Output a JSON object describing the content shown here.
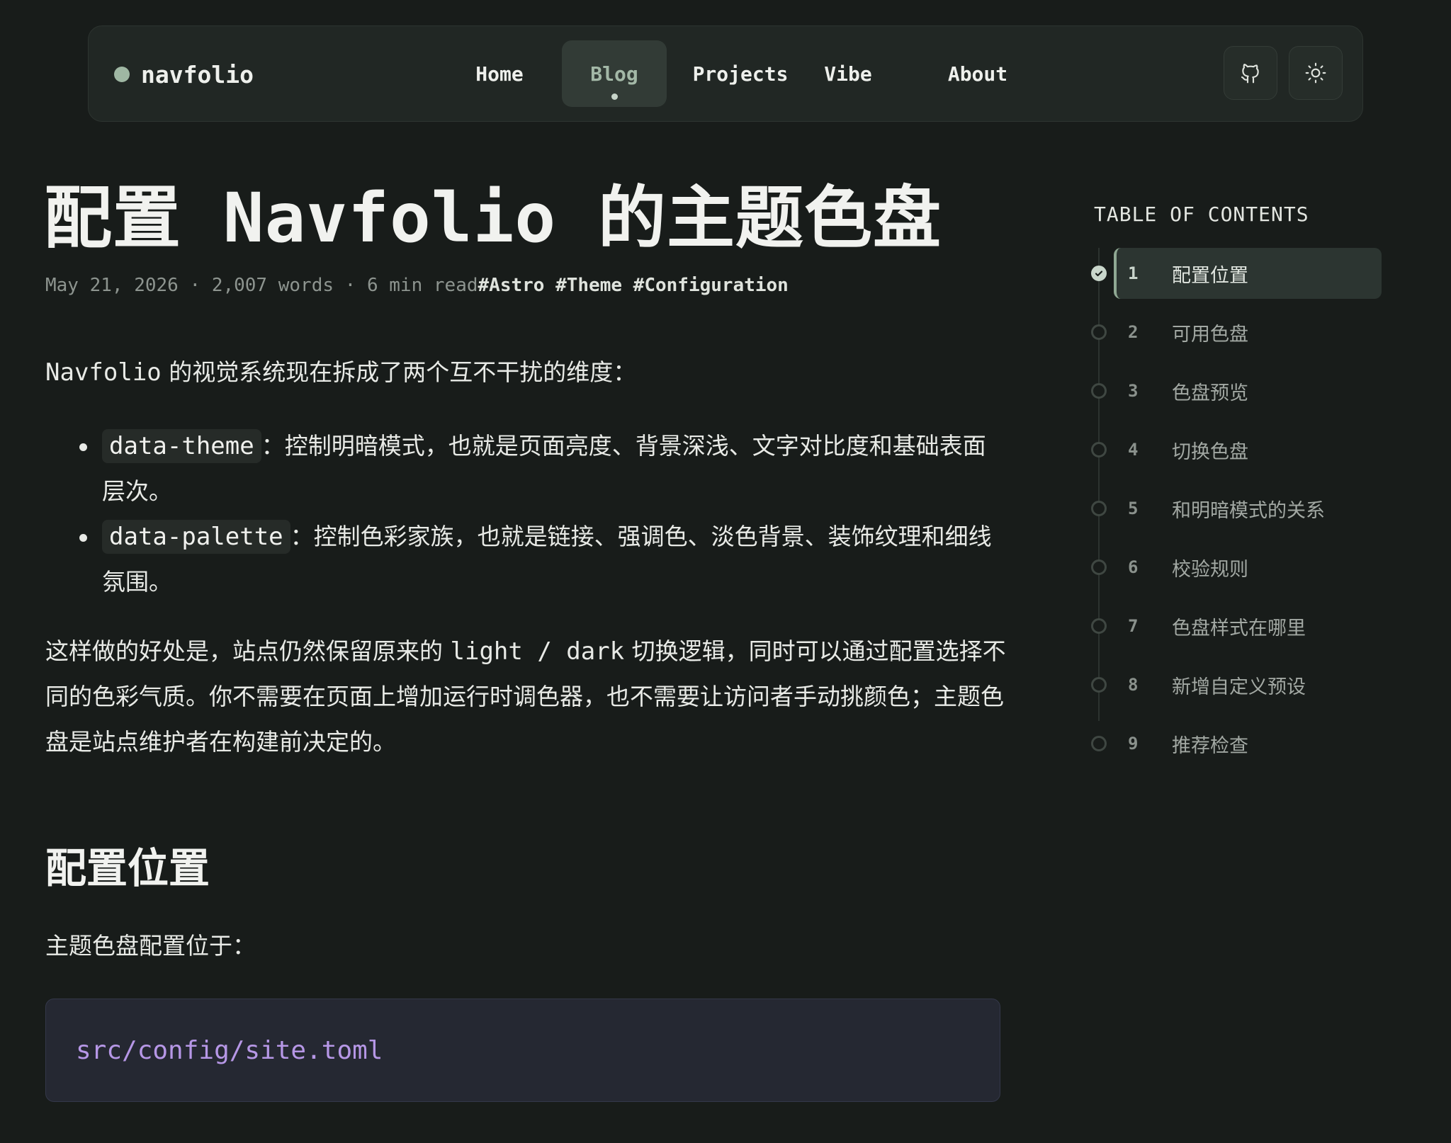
{
  "nav": {
    "brand": "navfolio",
    "links": [
      {
        "label": "Home"
      },
      {
        "label": "Blog"
      },
      {
        "label": "Projects"
      },
      {
        "label": "Vibe"
      },
      {
        "label": "About"
      }
    ],
    "active": "Blog",
    "github_icon": "github-icon",
    "theme_icon": "sun-icon"
  },
  "article": {
    "title": "配置 Navfolio 的主题色盘",
    "meta": {
      "date": "May 21, 2026",
      "sep": "·",
      "words": "2,007 words",
      "read": "6 min read",
      "tags": [
        "#Astro",
        "#Theme",
        "#Configuration"
      ]
    },
    "intro_code": "Navfolio",
    "intro_text": " 的视觉系统现在拆成了两个互不干扰的维度：",
    "bullets": [
      {
        "code": "data-theme",
        "text": "：控制明暗模式，也就是页面亮度、背景深浅、文字对比度和基础表面层次。"
      },
      {
        "code": "data-palette",
        "text": "：控制色彩家族，也就是链接、强调色、淡色背景、装饰纹理和细线氛围。"
      }
    ],
    "para2_a": "这样做的好处是，站点仍然保留原来的 ",
    "para2_code": "light / dark",
    "para2_b": " 切换逻辑，同时可以通过配置选择不同的色彩气质。你不需要在页面上增加运行时调色器，也不需要让访问者手动挑颜色；主题色盘是站点维护者在构建前决定的。",
    "h2": "配置位置",
    "para3": "主题色盘配置位于：",
    "code_block": "src/config/site.toml"
  },
  "toc": {
    "title": "TABLE OF CONTENTS",
    "items": [
      {
        "num": "1",
        "label": "配置位置"
      },
      {
        "num": "2",
        "label": "可用色盘"
      },
      {
        "num": "3",
        "label": "色盘预览"
      },
      {
        "num": "4",
        "label": "切换色盘"
      },
      {
        "num": "5",
        "label": "和明暗模式的关系"
      },
      {
        "num": "6",
        "label": "校验规则"
      },
      {
        "num": "7",
        "label": "色盘样式在哪里"
      },
      {
        "num": "8",
        "label": "新增自定义预设"
      },
      {
        "num": "9",
        "label": "推荐检查"
      }
    ],
    "active_index": 0
  },
  "colors": {
    "background": "#181c1a",
    "accent": "#a3b8a7",
    "code_text": "#b697e6"
  }
}
